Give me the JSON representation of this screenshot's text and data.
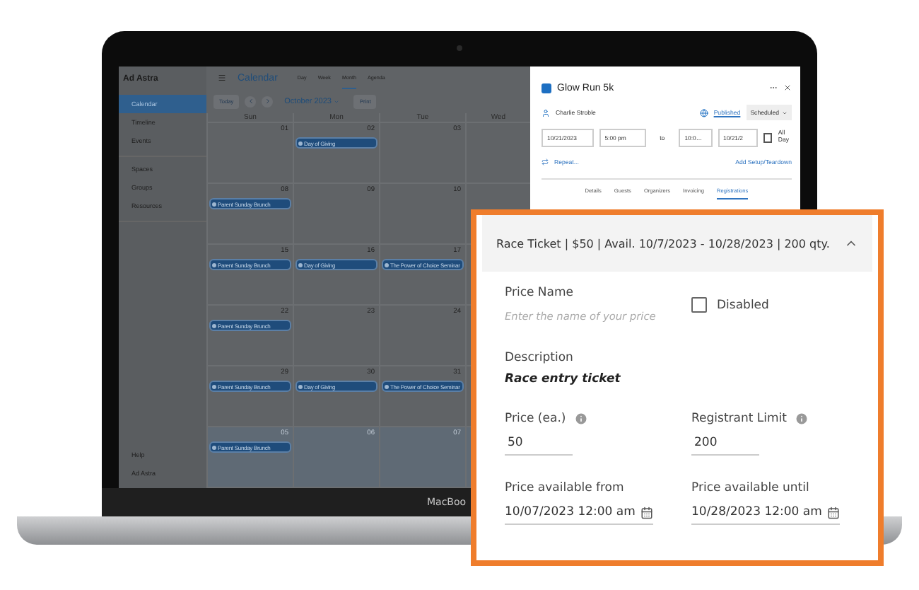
{
  "laptop": {
    "brand": "MacBoo"
  },
  "sidebar": {
    "logo": "Ad Astra",
    "item_groups": [
      {
        "items": [
          {
            "label": "Calendar",
            "selected": true
          },
          {
            "label": "Timeline",
            "selected": false
          },
          {
            "label": "Events",
            "selected": false
          }
        ]
      },
      {
        "items": [
          {
            "label": "Spaces",
            "selected": false
          },
          {
            "label": "Groups",
            "selected": false
          },
          {
            "label": "Resources",
            "selected": false
          }
        ]
      }
    ],
    "footer_items": [
      {
        "label": "Help",
        "selected": false
      },
      {
        "label": "Ad Astra",
        "selected": false
      }
    ]
  },
  "top_bar": {
    "title": "Calendar",
    "views": [
      {
        "label": "Day",
        "selected": false
      },
      {
        "label": "Week",
        "selected": false
      },
      {
        "label": "Month",
        "selected": true
      },
      {
        "label": "Agenda",
        "selected": false
      }
    ]
  },
  "toolbar": {
    "today": "Today",
    "month": "October 2023",
    "print": "Print"
  },
  "calendar": {
    "weekdays": [
      "Sun",
      "Mon",
      "Tue",
      "Wed"
    ],
    "weeks": [
      {
        "days": [
          {
            "date": "01",
            "other_month": false
          },
          {
            "date": "02",
            "other_month": false,
            "events": [
              "Day of Giving"
            ]
          },
          {
            "date": "03",
            "other_month": false
          }
        ]
      },
      {
        "days": [
          {
            "date": "08",
            "other_month": false,
            "events": [
              "Parent Sunday Brunch"
            ]
          },
          {
            "date": "09",
            "other_month": false
          },
          {
            "date": "10",
            "other_month": false
          }
        ]
      },
      {
        "days": [
          {
            "date": "15",
            "other_month": false,
            "events": [
              "Parent Sunday Brunch"
            ]
          },
          {
            "date": "16",
            "other_month": false,
            "events": [
              "Day of Giving"
            ]
          },
          {
            "date": "17",
            "other_month": false,
            "events": [
              "The Power of Choice Seminar"
            ]
          }
        ]
      },
      {
        "days": [
          {
            "date": "22",
            "other_month": false,
            "events": [
              "Parent Sunday Brunch"
            ]
          },
          {
            "date": "23",
            "other_month": false
          },
          {
            "date": "24",
            "other_month": false
          }
        ]
      },
      {
        "days": [
          {
            "date": "29",
            "other_month": false,
            "events": [
              "Parent Sunday Brunch"
            ]
          },
          {
            "date": "30",
            "other_month": false,
            "events": [
              "Day of Giving"
            ]
          },
          {
            "date": "31",
            "other_month": false,
            "events": [
              "The Power of Choice Seminar"
            ]
          }
        ]
      },
      {
        "days": [
          {
            "date": "05",
            "other_month": true,
            "events": [
              "Parent Sunday Brunch"
            ]
          },
          {
            "date": "06",
            "other_month": true
          },
          {
            "date": "07",
            "other_month": true
          }
        ]
      }
    ]
  },
  "event_panel": {
    "title": "Glow Run 5k",
    "organizer": "Charlie Stroble",
    "status_link": "Published",
    "status_select": "Scheduled",
    "start_date": "10/21/2023",
    "start_time": "5:00 pm",
    "separator": "to",
    "end_time": "10:0…",
    "end_date": "10/21/2",
    "all_day": {
      "label": "All Day",
      "checked": false
    },
    "repeat_link": "Repeat...",
    "setup_link": "Add Setup/Teardown",
    "tabs": [
      {
        "label": "Details",
        "selected": false
      },
      {
        "label": "Guests",
        "selected": false
      },
      {
        "label": "Organizers",
        "selected": false
      },
      {
        "label": "Invoicing",
        "selected": false
      },
      {
        "label": "Registrations",
        "selected": true
      }
    ]
  },
  "ticket_panel": {
    "header": "Race Ticket | $50 | Avail. 10/7/2023 - 10/28/2023 | 200 qty.",
    "expanded": true,
    "price_name": {
      "label": "Price Name",
      "placeholder": "Enter the name of your price"
    },
    "disabled": {
      "label": "Disabled",
      "checked": false
    },
    "description": {
      "label": "Description",
      "value": "Race entry ticket"
    },
    "price": {
      "label": "Price (ea.)",
      "value": "50"
    },
    "registrant_limit": {
      "label": "Registrant Limit",
      "value": "200"
    },
    "available_from": {
      "label": "Price available from",
      "value": "10/07/2023 12:00 am"
    },
    "available_until": {
      "label": "Price available until",
      "value": "10/28/2023 12:00 am"
    }
  }
}
